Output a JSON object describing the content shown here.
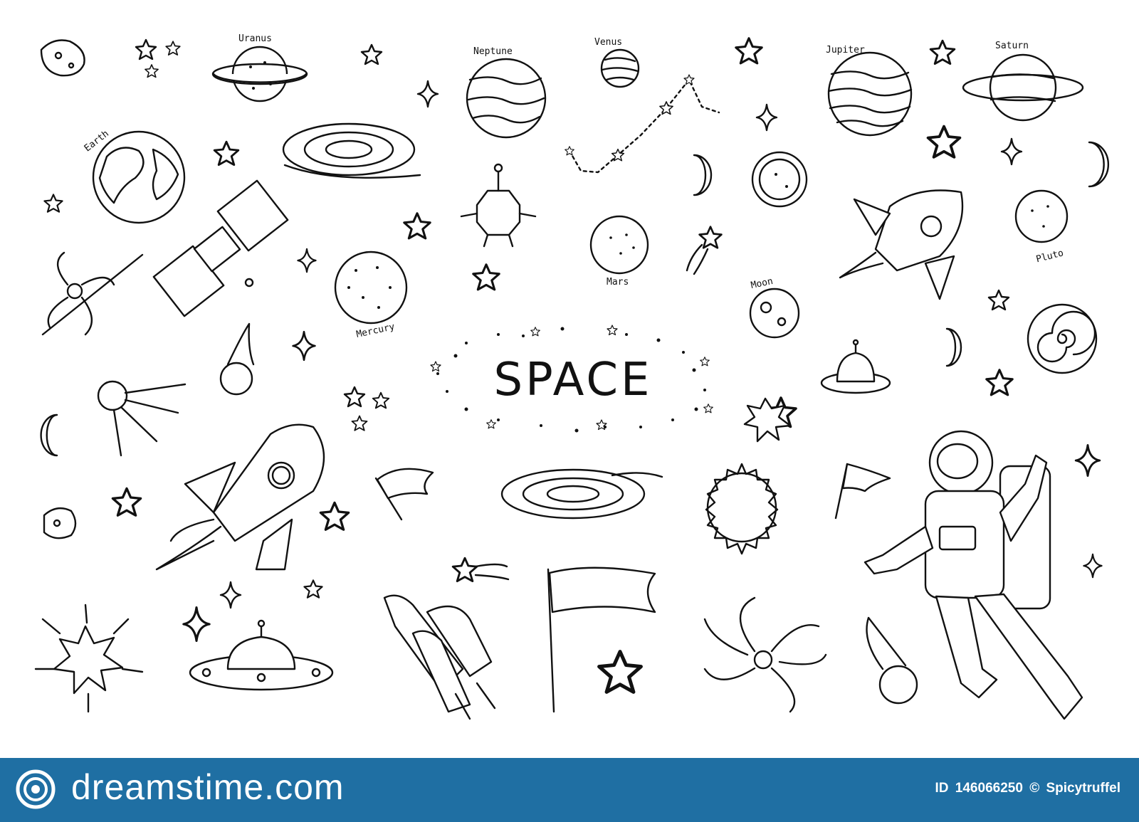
{
  "title": "SPACE",
  "labels": {
    "uranus": "Uranus",
    "neptune": "Neptune",
    "venus": "Venus",
    "jupiter": "Jupiter",
    "saturn": "Saturn",
    "earth": "Earth",
    "mars": "Mars",
    "moon": "Moon",
    "mercury": "Mercury",
    "pluto": "Pluto"
  },
  "footer": {
    "brand": "dreamstime.com",
    "id_label": "ID",
    "id_value": "146066250",
    "copyright": "©",
    "author": "Spicytruffel",
    "background_color": "#1f6fa3"
  }
}
